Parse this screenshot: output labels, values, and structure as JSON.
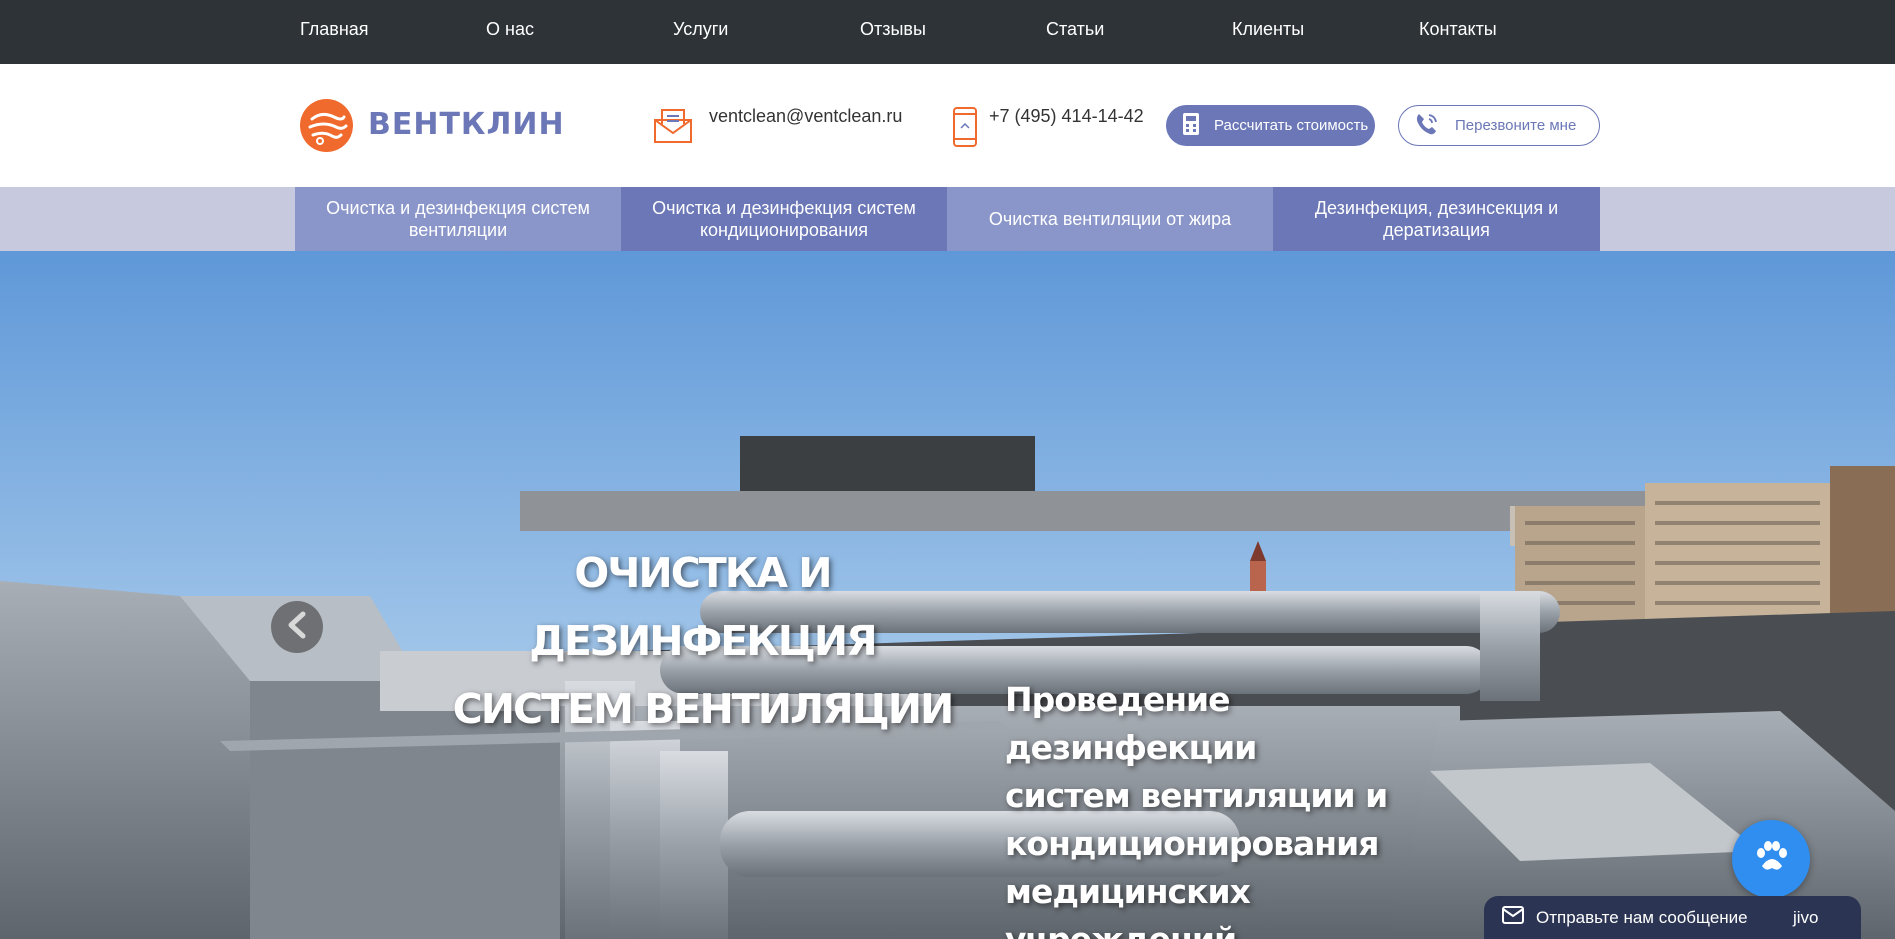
{
  "top_nav": {
    "items": [
      {
        "label": "Главная"
      },
      {
        "label": "О нас"
      },
      {
        "label": "Услуги"
      },
      {
        "label": "Отзывы"
      },
      {
        "label": "Статьи"
      },
      {
        "label": "Клиенты"
      },
      {
        "label": "Контакты"
      }
    ]
  },
  "header": {
    "logo_text": "ВЕНТКЛИН",
    "email": "ventclean@ventclean.ru",
    "phone": "+7 (495) 414-14-42",
    "calc_button": "Рассчитать стоимость",
    "callback_button": "Перезвоните мне"
  },
  "services": [
    {
      "label": "Очистка и дезинфекция систем вентиляции"
    },
    {
      "label": "Очистка и дезинфекция систем кондиционирования"
    },
    {
      "label": "Очистка вентиляции от жира"
    },
    {
      "label": "Дезинфекция, дезинсекция и дератизация"
    }
  ],
  "hero": {
    "title_line1": "ОЧИСТКА И ДЕЗИНФЕКЦИЯ",
    "title_line2": "СИСТЕМ ВЕНТИЛЯЦИИ",
    "subtitle_line1": "Проведение дезинфекции",
    "subtitle_line2": "систем вентиляции и",
    "subtitle_line3": "кондиционирования",
    "subtitle_line4": "медицинских учреждений"
  },
  "chat_widget": {
    "message_label": "Отправьте нам сообщение",
    "brand": "jivo"
  },
  "colors": {
    "top_nav_bg": "#2e3337",
    "accent": "#6b77b6",
    "accent_light": "#8a96c9",
    "logo_orange": "#f06a2d",
    "chat_blue": "#2f8ef0"
  },
  "icons": [
    "envelope-icon",
    "smartphone-icon",
    "calculator-icon",
    "phone-icon",
    "chevron-left-icon",
    "paw-icon",
    "mail-icon"
  ]
}
